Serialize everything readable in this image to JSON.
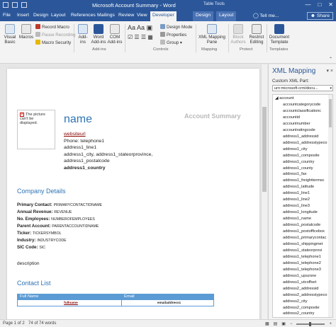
{
  "window": {
    "title": "Microsoft Account Summary  -  Word",
    "context_tab_group": "Table Tools",
    "controls": [
      "—",
      "□",
      "✕"
    ]
  },
  "tabs": [
    "File",
    "Insert",
    "Design",
    "Layout",
    "References",
    "Mailings",
    "Review",
    "View",
    "Developer",
    "Design",
    "Layout"
  ],
  "tell_me": "Tell me...",
  "share": "Share",
  "ribbon": {
    "code": {
      "visual_basic": "Visual Basic",
      "macros": "Macros",
      "record_macro": "Record Macro",
      "pause_recording": "Pause Recording",
      "macro_security": "Macro Security"
    },
    "addins": {
      "addins": "Add-ins",
      "word_addins": "Word Add-ins",
      "com_addins": "COM Add-ins",
      "group_label": "Add-ins"
    },
    "controls": {
      "design_mode": "Design Mode",
      "properties": "Properties",
      "group": "Group",
      "group_label": "Controls"
    },
    "mapping": {
      "xml_mapping_pane": "XML Mapping Pane",
      "group_label": "Mapping"
    },
    "protect": {
      "block_authors": "Block Authors",
      "restrict_editing": "Restrict Editing",
      "group_label": "Protect"
    },
    "templates": {
      "document_template": "Document Template",
      "group_label": "Templates"
    }
  },
  "document": {
    "picture_placeholder": "The picture can't be displayed.",
    "account_summary": "Account Summary",
    "name": "name",
    "websiteurl": "websiteurl",
    "phone": "Phone: telephone1",
    "address_line1": "address1_line1",
    "address_city": "address1_city, address1_stateorprovince,",
    "address_postal": "address1_postalcode",
    "address_country": "address1_country",
    "company_details_heading": "Company Details",
    "details": [
      {
        "label": "Primary Contact:",
        "value": "PRIMARYCONTACTIDNAME"
      },
      {
        "label": "Annual Revenue:",
        "value": "REVENUE"
      },
      {
        "label": "No. Employees:",
        "value": "NUMBEROFEMPLOYEES"
      },
      {
        "label": "Parent Account:",
        "value": "PARENTACCOUNTIDNAME"
      },
      {
        "label": "Ticker:",
        "value": "TICKERSYMBOL"
      },
      {
        "label": "Industry:",
        "value": "INDUSTRYCODE"
      },
      {
        "label": "SIC Code:",
        "value": "SIC"
      }
    ],
    "description": "description",
    "contact_list_heading": "Contact List",
    "table": {
      "headers": [
        "Full Name",
        "Email"
      ],
      "row": [
        "fullname",
        "emailaddress1"
      ]
    }
  },
  "xml_pane": {
    "title": "XML Mapping",
    "custom_part_label": "Custom XML Part:",
    "custom_part_value": "urn:microsoft-crm/docu...",
    "root": "account",
    "items": [
      "accountcategorycode",
      "accountclassificationc",
      "accountid",
      "accountnumber",
      "accountratingcode",
      "address1_addressid",
      "address1_addresstypeco",
      "address1_city",
      "address1_composite",
      "address1_country",
      "address1_county",
      "address1_fax",
      "address1_freighttermsc",
      "address1_latitude",
      "address1_line1",
      "address1_line2",
      "address1_line3",
      "address1_longitude",
      "address1_name",
      "address1_postalcode",
      "address1_postofficebox",
      "address1_primarycontac",
      "address1_shippingmet",
      "address1_stateorprovi",
      "address1_telephone1",
      "address1_telephone2",
      "address1_telephone3",
      "address1_upszone",
      "address1_utcoffset",
      "address2_addressid",
      "address2_addresstypeco",
      "address2_city",
      "address2_composite",
      "address2_country",
      "address2_county"
    ]
  },
  "status": {
    "page": "Page 1 of 2",
    "words": "74 of 74 words"
  }
}
